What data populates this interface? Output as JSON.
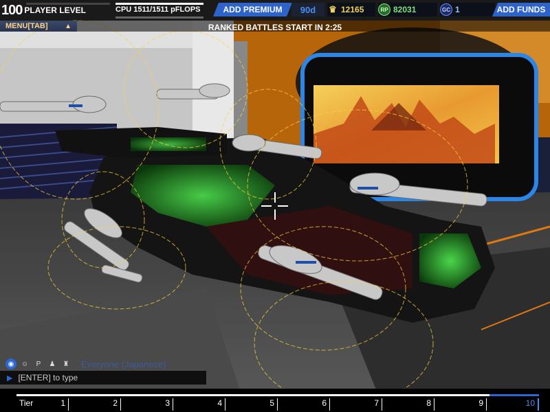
{
  "player": {
    "level": "100",
    "level_label": "PLAYER LEVEL",
    "level_progress": 0.0
  },
  "cpu": {
    "text": "CPU  1511/1511 pFLOPS",
    "used_fraction": 1.0
  },
  "premium": {
    "button": "ADD PREMIUM",
    "days": "90d"
  },
  "currencies": [
    {
      "name": "robits",
      "icon": "robits-icon",
      "value": "12165",
      "color": "#f0d35a"
    },
    {
      "name": "rp",
      "icon": "rp-coin-icon",
      "badge": "RP",
      "value": "82031",
      "color": "#7fe07f"
    },
    {
      "name": "gc",
      "icon": "gc-coin-icon",
      "badge": "GC",
      "value": "1",
      "color": "#9fbfff"
    }
  ],
  "funds_button": "ADD FUNDS",
  "menu": {
    "label": "MENU",
    "shortcut": "[TAB]"
  },
  "ranked_banner": "RANKED BATTLES START IN 2:25",
  "chat": {
    "channels": [
      "globe-icon",
      "person-icon",
      "party-icon",
      "friends-icon",
      "clan-icon"
    ],
    "active_channel": "Everyone (Japanese)",
    "input_placeholder": "[ENTER] to type"
  },
  "tiers": {
    "label": "Tier",
    "ticks": [
      "1",
      "2",
      "3",
      "4",
      "5",
      "6",
      "7",
      "8",
      "9",
      "10"
    ],
    "current": "10"
  },
  "accent": "#2a66d4"
}
